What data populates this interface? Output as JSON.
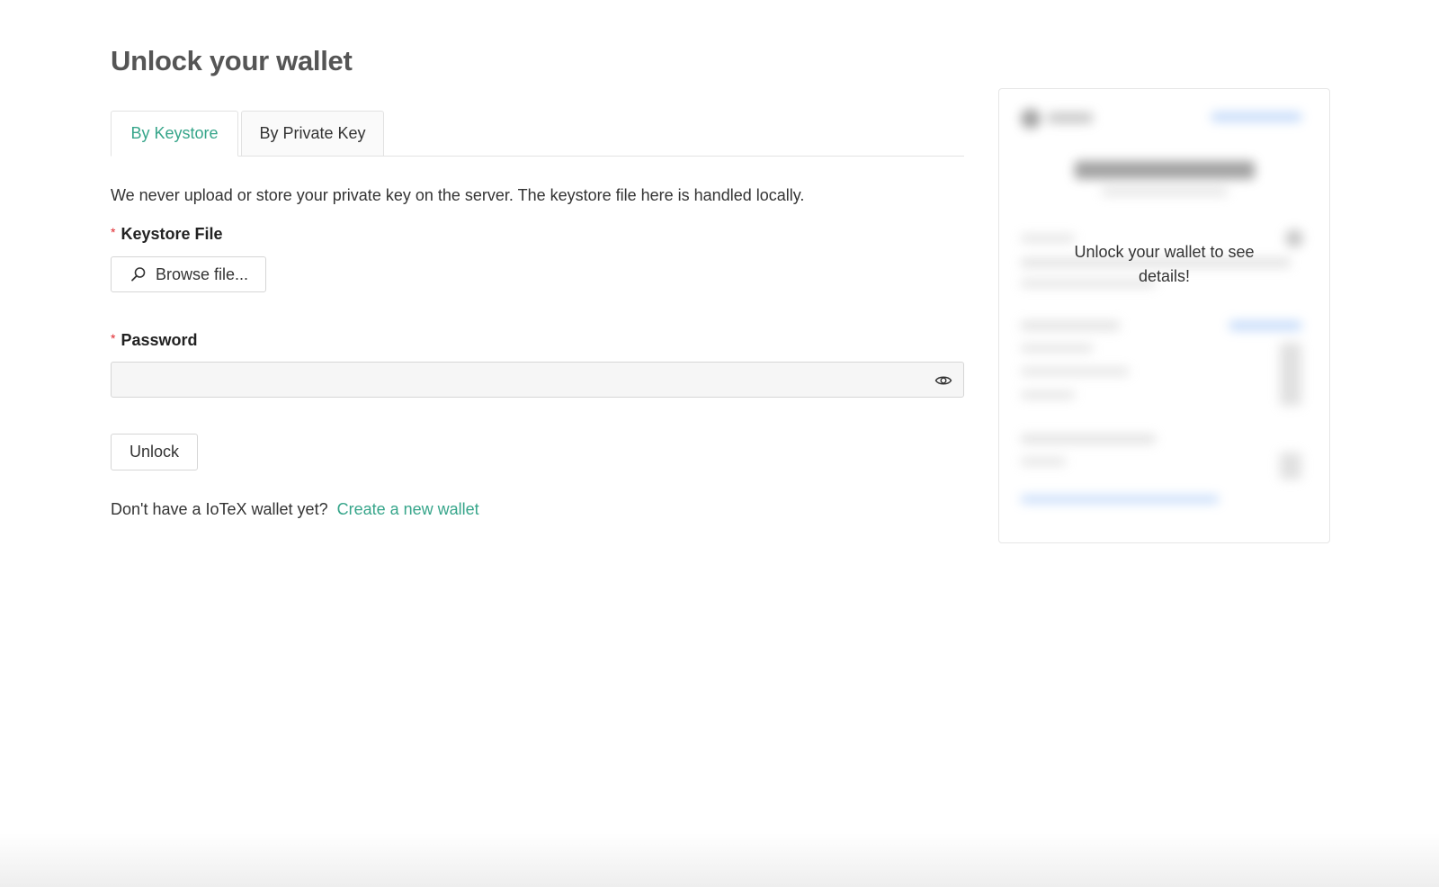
{
  "page": {
    "title": "Unlock your wallet"
  },
  "tabs": [
    {
      "label": "By Keystore",
      "active": true
    },
    {
      "label": "By Private Key",
      "active": false
    }
  ],
  "notice": "We never upload or store your private key on the server. The keystore file here is handled locally.",
  "keystore": {
    "required_mark": "*",
    "label": "Keystore File",
    "browse_label": "Browse file...",
    "browse_icon": "search-icon"
  },
  "password": {
    "required_mark": "*",
    "label": "Password",
    "value": "",
    "placeholder": "",
    "toggle_icon": "eye-icon"
  },
  "actions": {
    "unlock_label": "Unlock"
  },
  "signup": {
    "prompt": "Don't have a IoTeX wallet yet?",
    "link_label": "Create a new wallet"
  },
  "side_card": {
    "message": "Unlock your wallet to see details!"
  },
  "colors": {
    "accent": "#36a58a",
    "required": "#e0282e",
    "title": "#555555"
  }
}
